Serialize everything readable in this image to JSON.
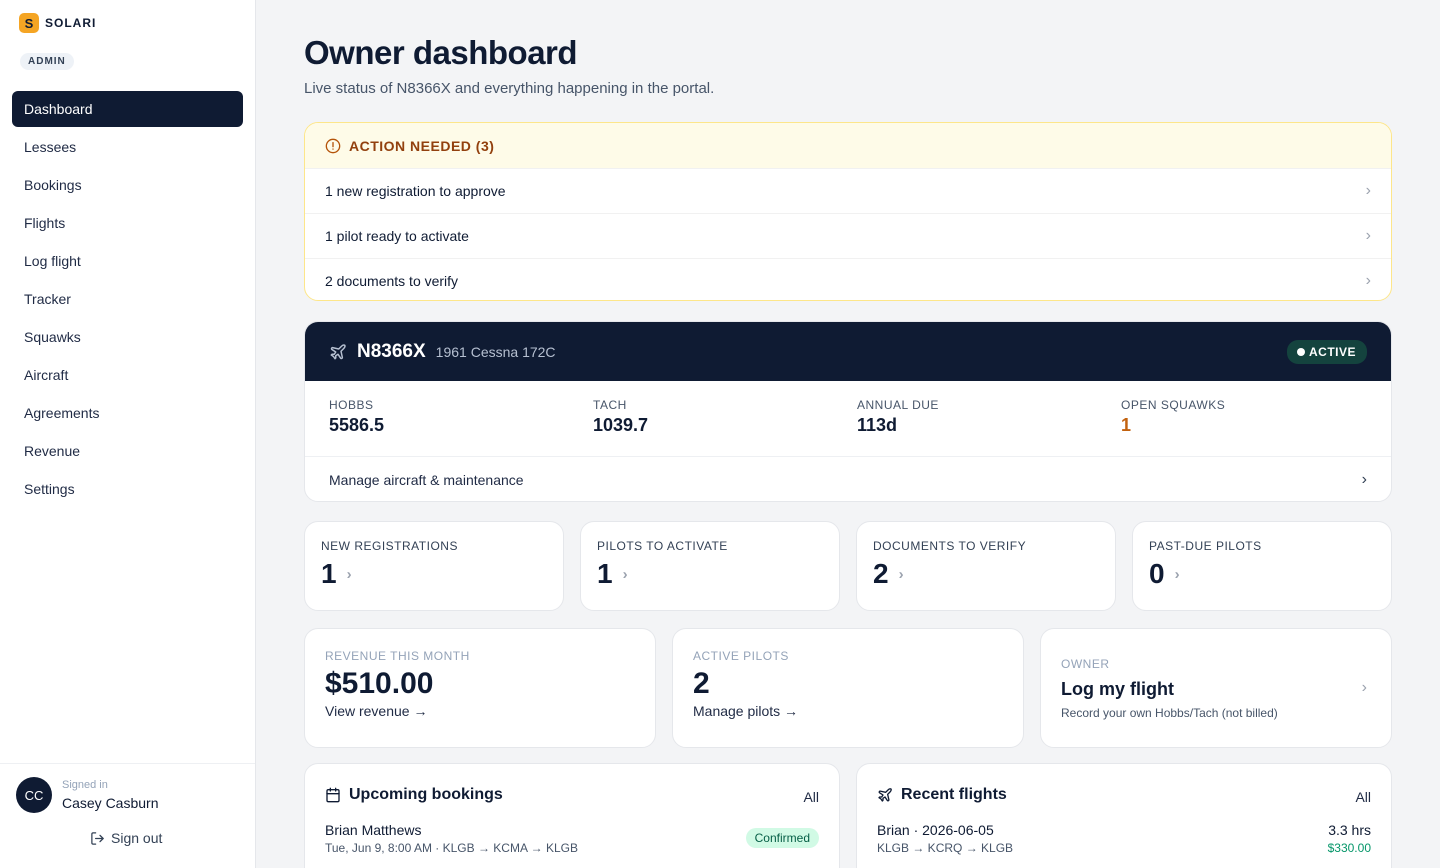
{
  "brand": {
    "mark": "S",
    "name": "SOLARI",
    "role": "ADMIN"
  },
  "nav": [
    {
      "label": "Dashboard",
      "active": true
    },
    {
      "label": "Lessees"
    },
    {
      "label": "Bookings"
    },
    {
      "label": "Flights"
    },
    {
      "label": "Log flight"
    },
    {
      "label": "Tracker"
    },
    {
      "label": "Squawks"
    },
    {
      "label": "Aircraft"
    },
    {
      "label": "Agreements"
    },
    {
      "label": "Revenue"
    },
    {
      "label": "Settings"
    }
  ],
  "user": {
    "initials": "CC",
    "signed_label": "Signed in",
    "name": "Casey Casburn",
    "signout": "Sign out"
  },
  "header": {
    "title": "Owner dashboard",
    "subtitle": "Live status of N8366X and everything happening in the portal."
  },
  "alert": {
    "title": "ACTION NEEDED (3)",
    "items": [
      "1 new registration to approve",
      "1 pilot ready to activate",
      "2 documents to verify"
    ]
  },
  "aircraft": {
    "tail": "N8366X",
    "model": "1961 Cessna 172C",
    "status": "ACTIVE",
    "stats": [
      {
        "label": "HOBBS",
        "value": "5586.5"
      },
      {
        "label": "TACH",
        "value": "1039.7"
      },
      {
        "label": "ANNUAL DUE",
        "value": "113d"
      },
      {
        "label": "OPEN SQUAWKS",
        "value": "1"
      }
    ],
    "manage": "Manage aircraft & maintenance"
  },
  "stats": [
    {
      "label": "NEW REGISTRATIONS",
      "value": "1"
    },
    {
      "label": "PILOTS TO ACTIVATE",
      "value": "1"
    },
    {
      "label": "DOCUMENTS TO VERIFY",
      "value": "2"
    },
    {
      "label": "PAST-DUE PILOTS",
      "value": "0"
    }
  ],
  "summary": {
    "revenue": {
      "label": "REVENUE THIS MONTH",
      "value": "$510.00",
      "link": "View revenue →"
    },
    "pilots": {
      "label": "ACTIVE PILOTS",
      "value": "2",
      "link": "Manage pilots →"
    },
    "owner": {
      "label": "OWNER",
      "title": "Log my flight",
      "subtitle": "Record your own Hobbs/Tach (not billed)"
    }
  },
  "bookings": {
    "title": "Upcoming bookings",
    "all": "All",
    "item": {
      "name": "Brian Matthews",
      "detail": "Tue, Jun 9, 8:00 AM · KLGB → KCMA → KLGB",
      "status": "Confirmed"
    }
  },
  "flights": {
    "title": "Recent flights",
    "all": "All",
    "item": {
      "name": "Brian · 2026-06-05",
      "route": "KLGB → KCRQ → KLGB",
      "hours": "3.3 hrs",
      "amount": "$330.00"
    }
  },
  "colors": {
    "navy": "#0f1b33",
    "accent": "#f5a524",
    "warn": "#c2620f",
    "success": "#059669"
  }
}
